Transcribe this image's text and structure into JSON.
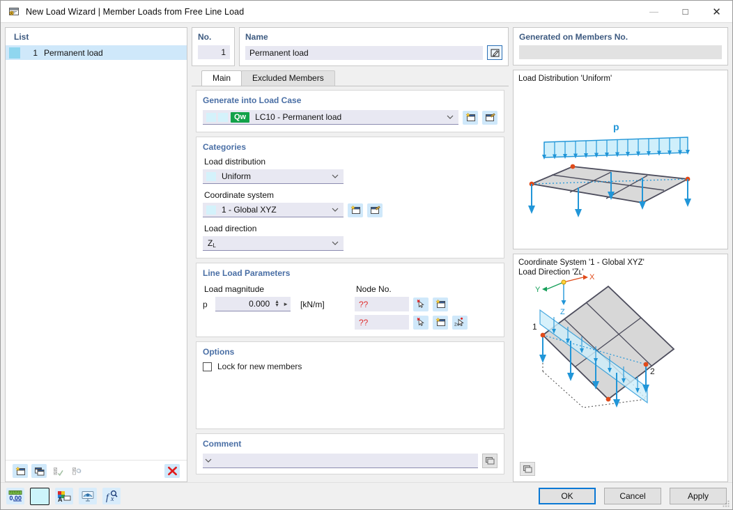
{
  "window": {
    "title": "New Load Wizard | Member Loads from Free Line Load",
    "icon": "wizard-icon",
    "minimize": "—",
    "maximize": "□",
    "close": "✕"
  },
  "list_panel": {
    "header": "List",
    "rows": [
      {
        "no": "1",
        "name": "Permanent load",
        "color": "#8fd6ef"
      }
    ],
    "toolbar": [
      {
        "name": "new-item-button",
        "icon": "new-window-icon",
        "enabled": true
      },
      {
        "name": "copy-item-button",
        "icon": "copy-window-icon",
        "enabled": true
      },
      {
        "name": "check-all-button",
        "icon": "checklist-check-icon",
        "enabled": false
      },
      {
        "name": "invert-selection-button",
        "icon": "checklist-refresh-icon",
        "enabled": false
      },
      {
        "name": "delete-item-button",
        "icon": "red-x-icon",
        "enabled": true
      }
    ]
  },
  "header_fields": {
    "no_label": "No.",
    "no_value": "1",
    "name_label": "Name",
    "name_value": "Permanent load",
    "edit_button_icon": "edit-pencil-icon"
  },
  "generated_on": {
    "label": "Generated on Members No.",
    "value": ""
  },
  "tabs": [
    {
      "label": "Main",
      "active": true
    },
    {
      "label": "Excluded Members",
      "active": false
    }
  ],
  "generate_into_load_case": {
    "group_label": "Generate into Load Case",
    "badge": "Qw",
    "badge_color": "#13a24a",
    "value": "LC10 - Permanent load",
    "new_button_icon": "new-load-case-icon",
    "edit_button_icon": "edit-load-case-icon"
  },
  "categories": {
    "group_label": "Categories",
    "load_distribution_label": "Load distribution",
    "load_distribution_value": "Uniform",
    "coordinate_system_label": "Coordinate system",
    "coordinate_system_value": "1 - Global XYZ",
    "coordinate_new_icon": "new-coordinate-system-icon",
    "coordinate_edit_icon": "edit-coordinate-system-icon",
    "load_direction_label": "Load direction",
    "load_direction_value": "Z",
    "load_direction_sub": "L"
  },
  "line_load_parameters": {
    "group_label": "Line Load Parameters",
    "magnitude_label": "Load magnitude",
    "magnitude_symbol": "p",
    "magnitude_value": "0.000",
    "magnitude_unit": "[kN/m]",
    "node_label": "Node No.",
    "node_rows": [
      {
        "value": "??",
        "buttons": [
          {
            "name": "pick-node-1-button",
            "icon": "pick-node-icon"
          },
          {
            "name": "new-node-1-button",
            "icon": "new-node-icon"
          }
        ]
      },
      {
        "value": "??",
        "buttons": [
          {
            "name": "pick-node-2-button",
            "icon": "pick-node-icon"
          },
          {
            "name": "new-node-2-button",
            "icon": "new-node-icon"
          },
          {
            "name": "pick-two-nodes-button",
            "icon": "pick-two-nodes-icon"
          }
        ]
      }
    ]
  },
  "options": {
    "group_label": "Options",
    "lock_label": "Lock for new members",
    "lock_checked": false
  },
  "comment": {
    "group_label": "Comment",
    "value": "",
    "library_button_icon": "comment-library-icon"
  },
  "preview_top": {
    "title": "Load Distribution 'Uniform'",
    "load_symbol": "p"
  },
  "preview_bottom": {
    "title": "Coordinate System '1 - Global XYZ'\nLoad Direction 'Zʟ'",
    "axis_x": "X",
    "axis_y": "Y",
    "axis_z": "Z",
    "node_1": "1",
    "node_2": "2",
    "render_button_icon": "render-settings-icon"
  },
  "status_toolbar": [
    {
      "name": "decimal-places-button",
      "icon": "decimal-places-icon",
      "label": "0,00"
    },
    {
      "name": "color-swatch-button",
      "icon": "color-swatch-icon",
      "color": "#ccf4fb"
    },
    {
      "name": "display-properties-button",
      "icon": "display-properties-icon"
    },
    {
      "name": "view-settings-button",
      "icon": "view-settings-icon"
    },
    {
      "name": "formula-button",
      "icon": "formula-icon"
    }
  ],
  "dialog_buttons": {
    "ok": "OK",
    "cancel": "Cancel",
    "apply": "Apply"
  }
}
